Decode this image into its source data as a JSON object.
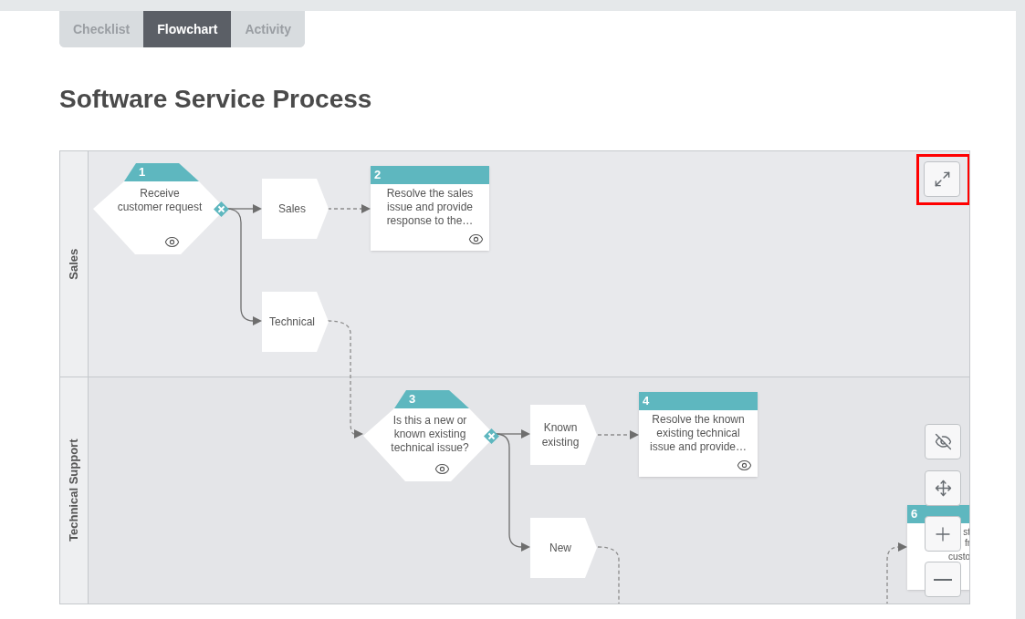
{
  "tabs": [
    {
      "label": "Checklist",
      "selected": false
    },
    {
      "label": "Flowchart",
      "selected": true
    },
    {
      "label": "Activity",
      "selected": false
    }
  ],
  "title": "Software Service Process",
  "lanes": [
    {
      "name": "Sales"
    },
    {
      "name": "Technical Support"
    }
  ],
  "nodes": [
    {
      "kind": "decision",
      "number": "1",
      "lines": [
        "Receive",
        "customer request"
      ]
    },
    {
      "kind": "label",
      "lines": [
        "Sales"
      ]
    },
    {
      "kind": "label",
      "lines": [
        "Technical"
      ]
    },
    {
      "kind": "task",
      "number": "2",
      "lines": [
        "Resolve the sales",
        "issue and provide",
        "response to the…"
      ]
    },
    {
      "kind": "decision",
      "number": "3",
      "lines": [
        "Is this a new or",
        "known existing",
        "technical issue?"
      ]
    },
    {
      "kind": "label",
      "lines": [
        "Known",
        "existing"
      ]
    },
    {
      "kind": "label",
      "lines": [
        "New"
      ]
    },
    {
      "kind": "task",
      "number": "4",
      "lines": [
        "Resolve the known",
        "existing technical",
        "issue and provide…"
      ]
    },
    {
      "kind": "task",
      "number": "6",
      "lines": [
        "st",
        "fr",
        "custo"
      ]
    }
  ],
  "controls": [
    {
      "kind": "expand",
      "highlighted": true
    },
    {
      "kind": "hide",
      "highlighted": false
    },
    {
      "kind": "center",
      "highlighted": false
    },
    {
      "kind": "zoom-in",
      "highlighted": false
    },
    {
      "kind": "zoom-out",
      "highlighted": false
    }
  ]
}
